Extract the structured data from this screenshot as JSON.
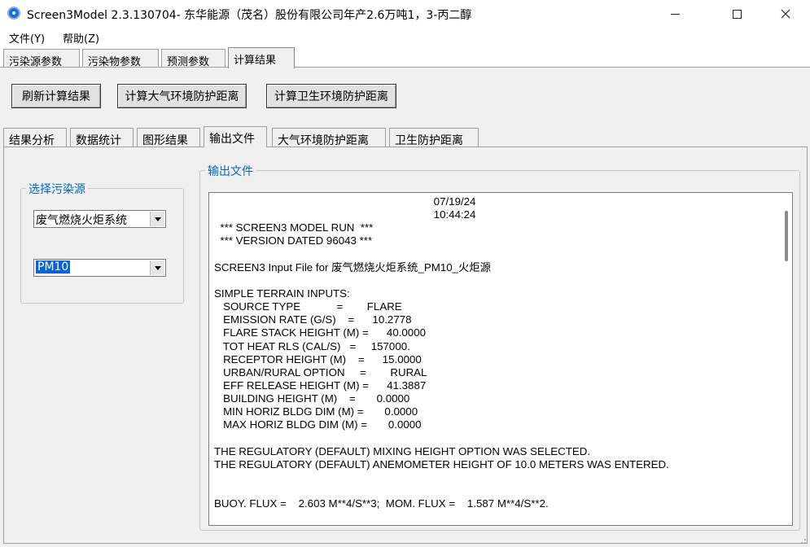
{
  "window": {
    "title": "Screen3Model 2.3.130704- 东华能源（茂名）股份有限公司年产2.6万吨1，3-丙二醇"
  },
  "menu": {
    "file": "文件(Y)",
    "help": "帮助(Z)"
  },
  "top_tabs": [
    "污染源参数",
    "污染物参数",
    "预测参数",
    "计算结果"
  ],
  "buttons": {
    "refresh": "刷新计算结果",
    "calc_air": "计算大气环境防护距离",
    "calc_health": "计算卫生环境防护距离"
  },
  "inner_tabs": [
    "结果分析",
    "数据统计",
    "图形结果",
    "输出文件",
    "大气环境防护距离",
    "卫生防护距离"
  ],
  "source_group": {
    "legend": "选择污染源",
    "source_value": "废气燃烧火炬系统",
    "pollutant_value": "PM10"
  },
  "output_group": {
    "legend": "输出文件",
    "lines": [
      "                                                                         07/19/24",
      "                                                                         10:44:24",
      "  *** SCREEN3 MODEL RUN  ***",
      "  *** VERSION DATED 96043 ***",
      "",
      "SCREEN3 Input File for 废气燃烧火炬系统_PM10_火炬源",
      "",
      "SIMPLE TERRAIN INPUTS:",
      "   SOURCE TYPE            =        FLARE",
      "   EMISSION RATE (G/S)    =      10.2778",
      "   FLARE STACK HEIGHT (M) =      40.0000",
      "   TOT HEAT RLS (CAL/S)   =     157000.",
      "   RECEPTOR HEIGHT (M)    =      15.0000",
      "   URBAN/RURAL OPTION     =        RURAL",
      "   EFF RELEASE HEIGHT (M) =      41.3887",
      "   BUILDING HEIGHT (M)    =       0.0000",
      "   MIN HORIZ BLDG DIM (M) =       0.0000",
      "   MAX HORIZ BLDG DIM (M) =       0.0000",
      "",
      "THE REGULATORY (DEFAULT) MIXING HEIGHT OPTION WAS SELECTED.",
      "THE REGULATORY (DEFAULT) ANEMOMETER HEIGHT OF 10.0 METERS WAS ENTERED.",
      "",
      "",
      "BUOY. FLUX =    2.603 M**4/S**3;  MOM. FLUX =    1.587 M**4/S**2."
    ]
  },
  "colors": {
    "legend_blue": "#0066cc",
    "selection_blue": "#0a64d7"
  }
}
